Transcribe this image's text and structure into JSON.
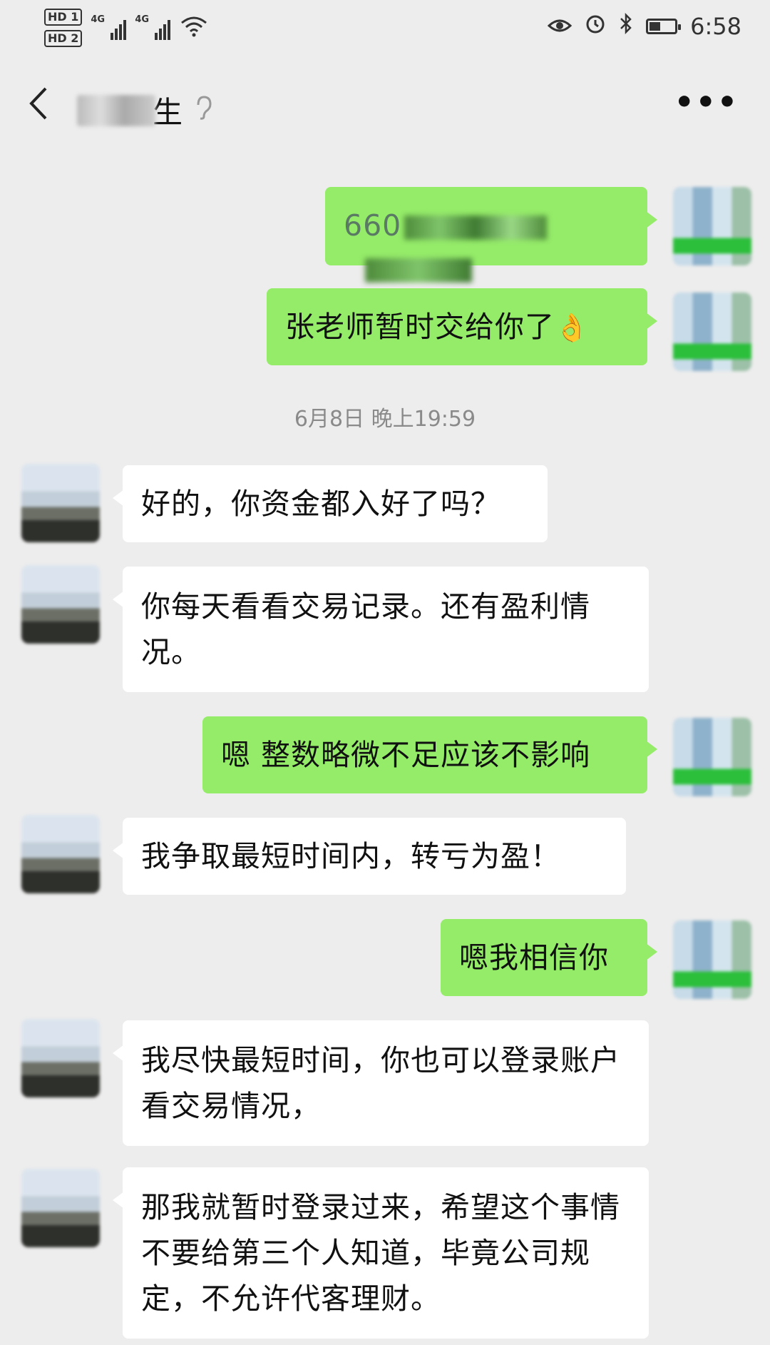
{
  "status_bar": {
    "hd1": "HD 1",
    "hd2": "HD 2",
    "sig1_label": "4G",
    "sig2_label": "4G",
    "time": "6:58",
    "battery_level": 0.45
  },
  "nav": {
    "back_glyph": "〈",
    "contact_name": "生",
    "ear_glyph": "ʕ",
    "more_glyph": "•••"
  },
  "messages": [
    {
      "side": "self",
      "text": "660"
    },
    {
      "side": "self",
      "text": "张老师暂时交给你了",
      "emoji": "👌"
    },
    {
      "side": "other",
      "text": "好的，你资金都入好了吗？"
    },
    {
      "side": "other",
      "text": "你每天看看交易记录。还有盈利情况。"
    },
    {
      "side": "self",
      "text": "嗯 整数略微不足应该不影响"
    },
    {
      "side": "other",
      "text": "我争取最短时间内，转亏为盈！"
    },
    {
      "side": "self",
      "text": "嗯我相信你"
    },
    {
      "side": "other",
      "text": "我尽快最短时间，你也可以登录账户看交易情况，"
    },
    {
      "side": "other",
      "text": "那我就暂时登录过来，希望这个事情不要给第三个人知道，毕竟公司规定，不允许代客理财。"
    }
  ],
  "timestamp": "6月8日 晚上19:59",
  "colors": {
    "background": "#ededed",
    "self_bubble": "#95ec69",
    "other_bubble": "#ffffff"
  }
}
